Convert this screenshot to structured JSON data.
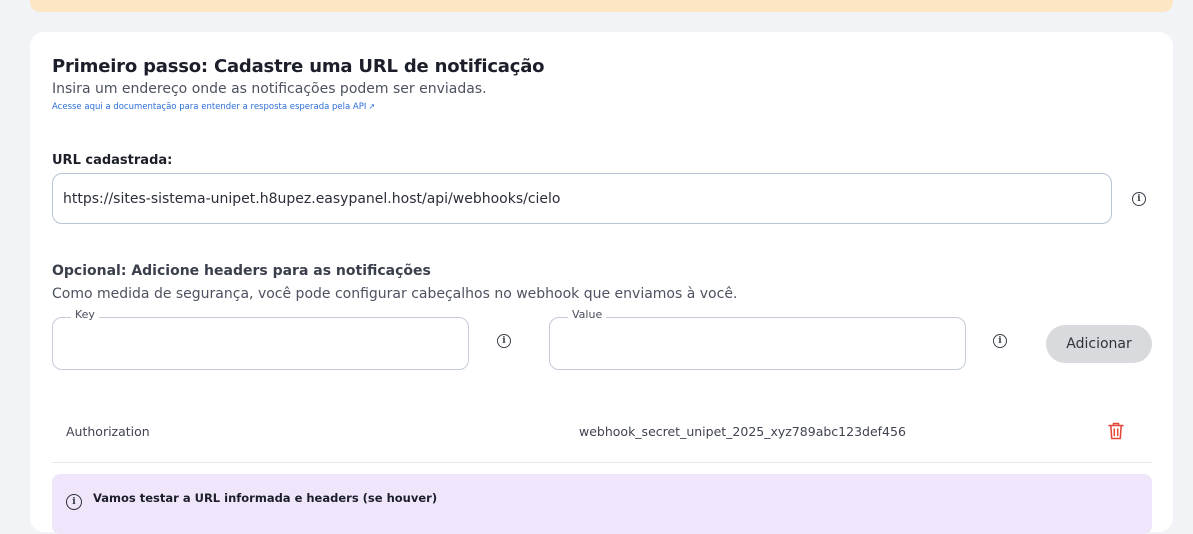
{
  "card": {
    "title": "Primeiro passo: Cadastre uma URL de notificação",
    "subtitle": "Insira um endereço onde as notificações podem ser enviadas.",
    "doc_link": "Acesse aqui a documentação para entender a resposta esperada pela API",
    "doc_link_icon": "external-link-icon"
  },
  "url_section": {
    "label": "URL cadastrada:",
    "value": "https://sites-sistema-unipet.h8upez.easypanel.host/api/webhooks/cielo"
  },
  "headers_section": {
    "title": "Opcional: Adicione headers para as notificações",
    "subtitle": "Como medida de segurança, você pode configurar cabeçalhos no webhook que enviamos à você.",
    "key_label": "Key",
    "key_value": "",
    "value_label": "Value",
    "value_value": "",
    "add_button": "Adicionar"
  },
  "headers_list": [
    {
      "key": "Authorization",
      "value": "webhook_secret_unipet_2025_xyz789abc123def456"
    }
  ],
  "notice": {
    "text": "Vamos testar a URL informada e headers (se houver)"
  },
  "colors": {
    "banner": "#fde6c4",
    "link": "#2c6fd6",
    "delete": "#e5483b",
    "notice_bg": "#efe6fb"
  }
}
